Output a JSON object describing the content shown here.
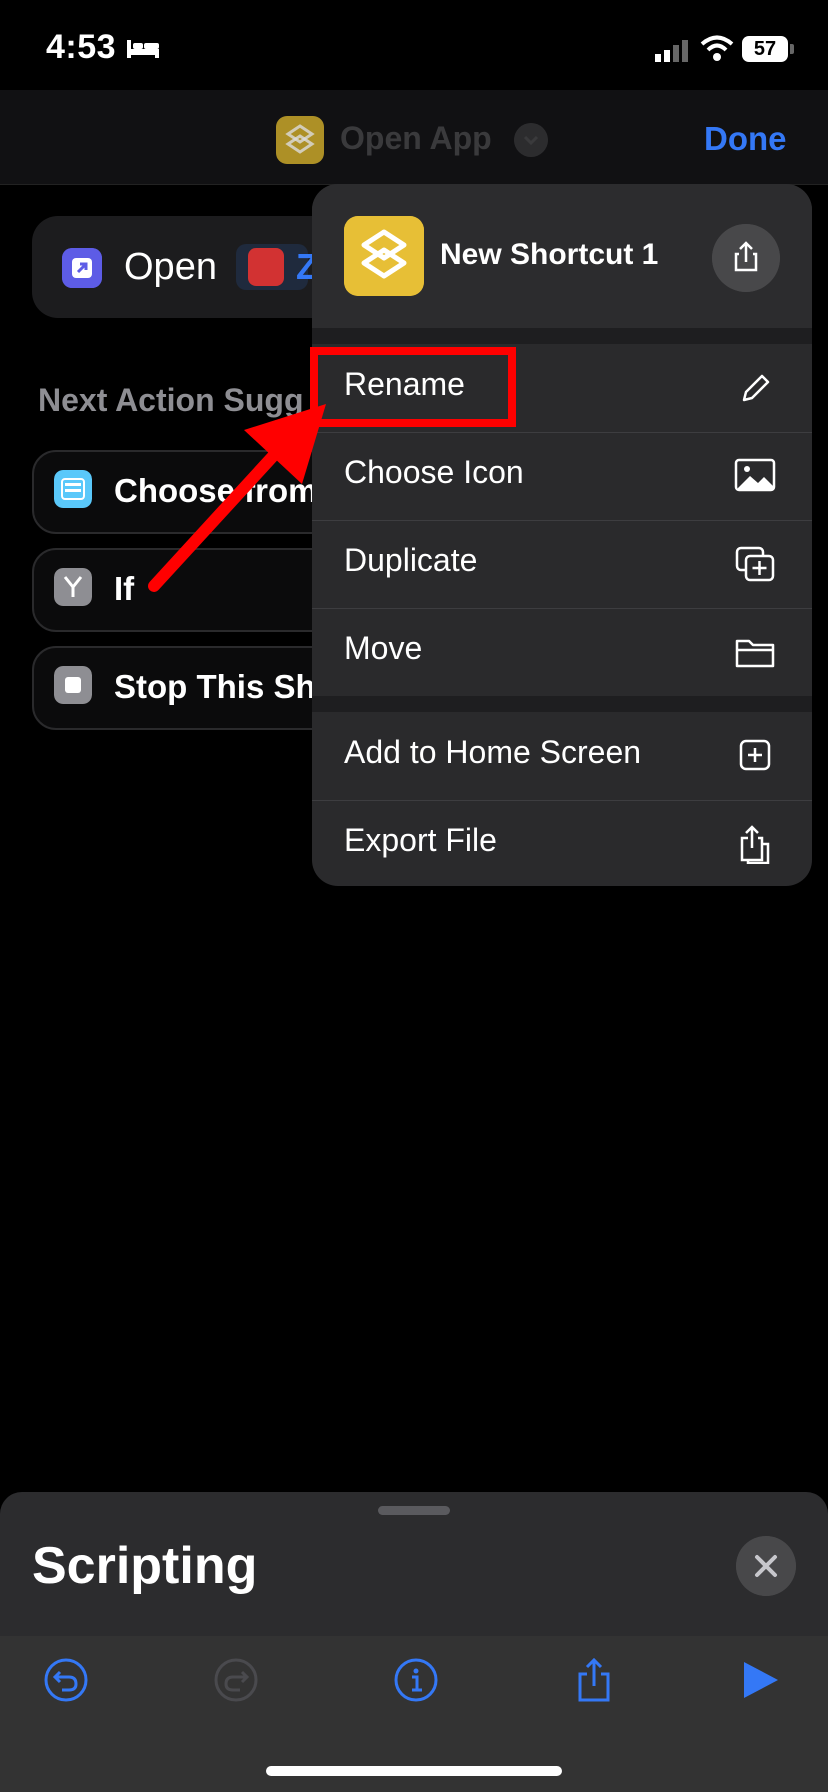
{
  "status": {
    "time": "4:53",
    "battery": "57"
  },
  "nav": {
    "title": "Open App",
    "done": "Done"
  },
  "action": {
    "open_label": "Open",
    "app_letter": "Z"
  },
  "suggestions": {
    "title": "Next Action Sugg",
    "items": [
      "Choose from",
      "If",
      "Stop This Sh"
    ]
  },
  "menu": {
    "shortcut_name": "New Shortcut 1",
    "items": [
      "Rename",
      "Choose Icon",
      "Duplicate",
      "Move",
      "Add to Home Screen",
      "Export File"
    ]
  },
  "sheet": {
    "title": "Scripting"
  },
  "colors": {
    "accent": "#3478f6",
    "annotation": "#ff0000",
    "shortcut_icon": "#e7bf36"
  }
}
